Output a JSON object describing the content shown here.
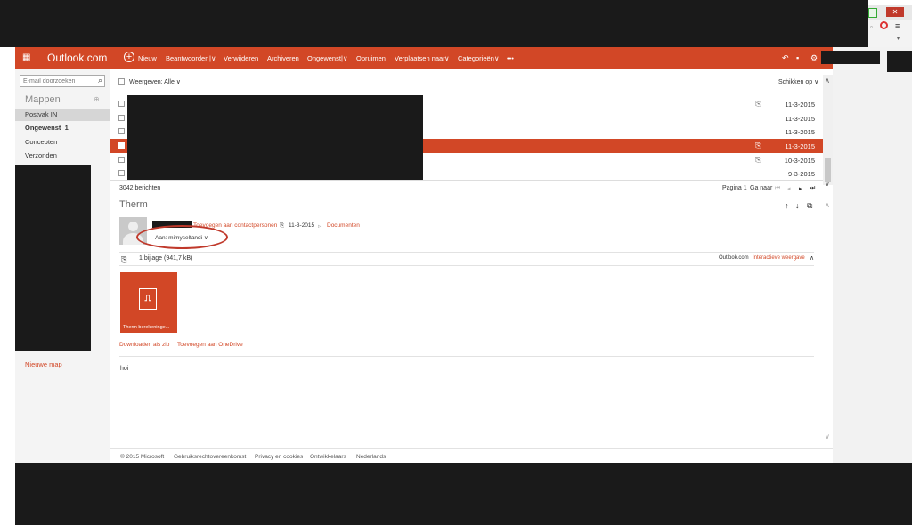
{
  "app": {
    "brand": "Outlook.com"
  },
  "toolbar": {
    "new": "Nieuw",
    "reply": "Beantwoorden",
    "delete": "Verwijderen",
    "archive": "Archiveren",
    "junk": "Ongewenst",
    "sweep": "Opruimen",
    "move": "Verplaatsen naar",
    "categories": "Categorieën",
    "more": "•••"
  },
  "sidebar": {
    "search_placeholder": "E-mail doorzoeken",
    "folders_heading": "Mappen",
    "items": [
      {
        "label": "Postvak IN"
      },
      {
        "label": "Ongewenst",
        "count": "1"
      },
      {
        "label": "Concepten"
      },
      {
        "label": "Verzonden"
      }
    ],
    "new_folder": "Nieuwe map"
  },
  "list": {
    "filter": "Weergeven: Alle",
    "sort": "Schikken op",
    "rows": [
      {
        "date": "11-3-2015",
        "attachment": true,
        "selected": false
      },
      {
        "date": "11-3-2015",
        "attachment": false,
        "selected": false
      },
      {
        "date": "11-3-2015",
        "attachment": false,
        "selected": false
      },
      {
        "date": "11-3-2015",
        "attachment": true,
        "selected": true
      },
      {
        "date": "10-3-2015",
        "attachment": true,
        "selected": false
      },
      {
        "date": "9-3-2015",
        "attachment": false,
        "selected": false
      }
    ],
    "count": "3042 berichten",
    "page": "Pagina 1",
    "goto": "Ga naar"
  },
  "message": {
    "subject": "Therm",
    "add_contact": "Toevoegen aan contactpersonen",
    "date": "11-3-2015",
    "documents": "Documenten",
    "to": "Aan: mimyselfandi",
    "attachment_summary": "1 bijlage (941,7 kB)",
    "interactive_view_prefix": "Outlook.com",
    "interactive_view": "Interactieve weergave",
    "attachment_name": "Therm berekeninge...",
    "download_zip": "Downloaden als zip",
    "add_onedrive": "Toevoegen aan OneDrive",
    "body": "hoi"
  },
  "footer": {
    "copyright": "© 2015 Microsoft",
    "terms": "Gebruiksrechtovereenkomst",
    "privacy": "Privacy en cookies",
    "developers": "Ontwikkelaars",
    "language": "Nederlands"
  },
  "colors": {
    "accent": "#d24726",
    "redact": "#1a1a1a"
  }
}
